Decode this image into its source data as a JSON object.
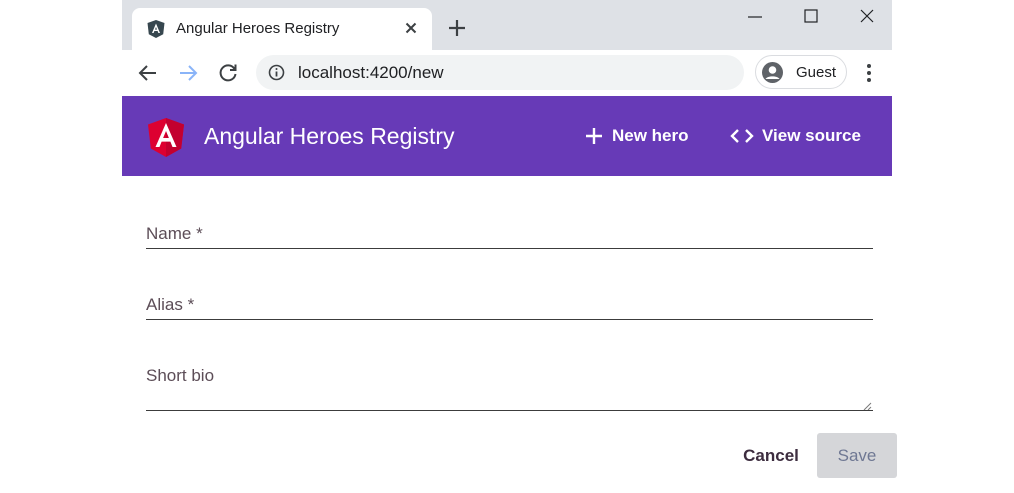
{
  "browser": {
    "tab": {
      "title": "Angular Heroes Registry",
      "favicon": "angular-icon",
      "close_icon": "close-icon"
    },
    "new_tab_icon": "plus-icon",
    "window_controls": [
      "minimize-icon",
      "maximize-icon",
      "close-icon"
    ],
    "toolbar": {
      "back_icon": "back-arrow-icon",
      "forward_icon": "forward-arrow-icon",
      "reload_icon": "reload-icon",
      "site_info_icon": "info-icon",
      "url": "localhost:4200/new",
      "profile": {
        "label": "Guest",
        "icon": "account-icon"
      },
      "menu_icon": "kebab-menu-icon"
    }
  },
  "app": {
    "header": {
      "logo": "angular-logo",
      "title": "Angular Heroes Registry",
      "nav": [
        {
          "label": "New hero",
          "icon": "plus-icon"
        },
        {
          "label": "View source",
          "icon": "code-icon"
        }
      ]
    },
    "form": {
      "fields": [
        {
          "label": "Name *",
          "value": ""
        },
        {
          "label": "Alias *",
          "value": ""
        },
        {
          "label": "Short bio",
          "value": ""
        }
      ],
      "actions": {
        "cancel_label": "Cancel",
        "save_label": "Save"
      }
    },
    "colors": {
      "primary": "#673ab7",
      "tabstrip": "#dee1e6",
      "save_disabled_bg": "#d5d6d9"
    }
  }
}
